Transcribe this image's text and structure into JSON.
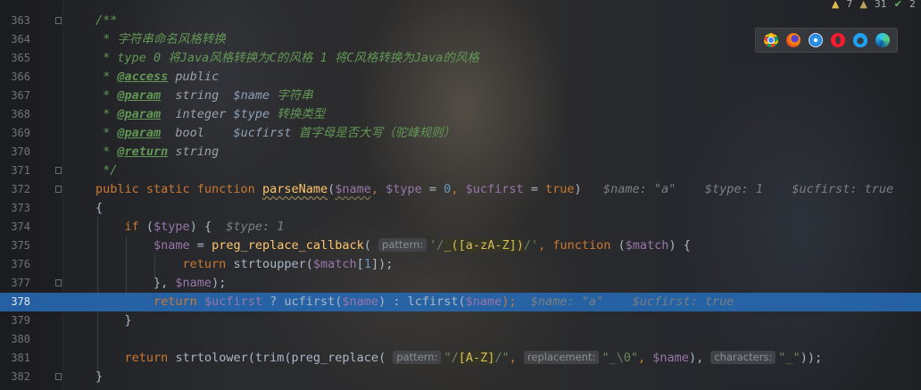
{
  "status": {
    "warnings": "7",
    "weak_warnings": "31",
    "ok": "2",
    "warning_icon": "warning-triangle-icon",
    "weak_icon": "weak-warning-icon",
    "ok_icon": "check-icon"
  },
  "browsers": [
    "chrome-icon",
    "firefox-icon",
    "safari-icon",
    "opera-icon",
    "ie-icon",
    "edge-icon"
  ],
  "colors": {
    "current_line": "#2d6db4",
    "keyword": "#cc7832",
    "function": "#ffc66d",
    "string": "#6a8759",
    "comment": "#629755",
    "number": "#6897bb"
  },
  "lines": [
    {
      "n": "363",
      "t": {
        "a": "/**"
      }
    },
    {
      "n": "364",
      "t": {
        "a": " * 字符串命名风格转换"
      }
    },
    {
      "n": "365",
      "t": {
        "a": " * type 0 将Java风格转换为C的风格 1 将C风格转换为Java的风格"
      }
    },
    {
      "n": "366",
      "t": {
        "a": " * ",
        "tag": "@access",
        "b": " public"
      }
    },
    {
      "n": "367",
      "t": {
        "a": " * ",
        "tag": "@param",
        "type": "  string  ",
        "var": "$name",
        "b": " 字符串"
      }
    },
    {
      "n": "368",
      "t": {
        "a": " * ",
        "tag": "@param",
        "type": "  integer ",
        "var": "$type",
        "b": " 转换类型"
      }
    },
    {
      "n": "369",
      "t": {
        "a": " * ",
        "tag": "@param",
        "type": "  bool    ",
        "var": "$ucfirst",
        "b": " 首字母是否大写（驼峰规则）"
      }
    },
    {
      "n": "370",
      "t": {
        "a": " * ",
        "tag": "@return",
        "type": " string"
      }
    },
    {
      "n": "371",
      "t": {
        "a": " */"
      }
    },
    {
      "n": "372",
      "t": {
        "kw": "public static function ",
        "fn": "parseName",
        "p1": "(",
        "v1": "$name",
        ", ": ", ",
        "v2": "$type",
        " = ": " = ",
        "num": "0",
        "v3": "$ucfirst",
        "true": "true",
        ")": ")",
        "h1": "$name: \"a\"",
        "h2": "$type: 1",
        "h3": "$ucfirst: true"
      }
    },
    {
      "n": "373",
      "t": {
        "a": "{"
      }
    },
    {
      "n": "374",
      "t": {
        "kw": "if",
        "v": "$type",
        "h": "$type: 1"
      }
    },
    {
      "n": "375",
      "t": {
        "v": "$name",
        "fn": "preg_replace_callback",
        "hint": "pattern:",
        "rx": "_([a-zA-Z])",
        "kw": "function",
        "v2": "$match"
      }
    },
    {
      "n": "376",
      "t": {
        "kw": "return",
        "fn": "strtoupper",
        "v": "$match",
        "idx": "1"
      }
    },
    {
      "n": "377",
      "t": {
        "v": "$name"
      }
    },
    {
      "n": "378",
      "t": {
        "kw": "return",
        "v": "$ucfirst",
        "fn1": "ucfirst",
        "v2": "$name",
        "fn2": "lcfirst",
        "v3": "$name",
        "h1": "$name: \"a\"",
        "h2": "$ucfirst: true"
      }
    },
    {
      "n": "379",
      "t": {
        "a": "}"
      }
    },
    {
      "n": "380",
      "t": {
        "a": ""
      }
    },
    {
      "n": "381",
      "t": {
        "kw": "return",
        "fn1": "strtolower",
        "fn2": "trim",
        "fn3": "preg_replace",
        "hp": "pattern:",
        "rx": "[A-Z]",
        "hr": "replacement:",
        "s2": "_\\0",
        "v": "$name",
        "hc": "characters:",
        "s3": "_"
      }
    },
    {
      "n": "382",
      "t": {
        "a": "}"
      }
    }
  ]
}
